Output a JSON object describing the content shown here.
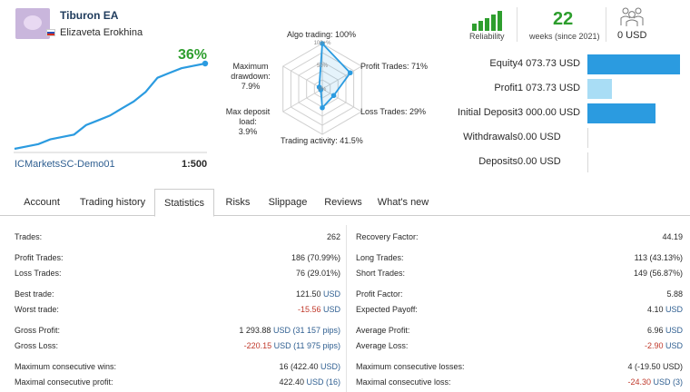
{
  "header": {
    "title": "Tiburon EA",
    "author": "Elizaveta Erokhina",
    "growth": "36%",
    "account": "ICMarketsSC-Demo01",
    "leverage": "1:500"
  },
  "growth_chart": {
    "values": [
      0,
      1,
      2,
      4,
      5,
      6,
      10,
      12,
      14,
      17,
      20,
      24,
      30,
      32,
      34,
      35,
      36
    ]
  },
  "radar": {
    "scale": [
      "100+%",
      "50%",
      "0%"
    ],
    "labels": {
      "algo": "Algo trading: 100%",
      "profit": "Profit Trades: 71%",
      "loss": "Loss Trades: 29%",
      "activity": "Trading activity: 41.5%",
      "load_1": "Max deposit load:",
      "load_2": "3.9%",
      "dd_1": "Maximum",
      "dd_2": "drawdown: 7.9%"
    },
    "values": [
      100,
      71,
      29,
      41.5,
      3.9,
      7.9
    ]
  },
  "metrics": {
    "reliability_label": "Reliability",
    "reliability_bars": 5,
    "weeks": "22",
    "weeks_label": "weeks (since 2021)",
    "subscribers": "0 USD"
  },
  "financials": [
    {
      "name": "Equity",
      "value": "4 073.73 USD",
      "fill": 1.0,
      "color": "#2b9be0"
    },
    {
      "name": "Profit",
      "value": "1 073.73 USD",
      "fill": 0.26,
      "color": "#a9ddf5"
    },
    {
      "name": "Initial Deposit",
      "value": "3 000.00 USD",
      "fill": 0.74,
      "color": "#2b9be0"
    },
    {
      "name": "Withdrawals",
      "value": "0.00 USD",
      "fill": 0,
      "color": "#2b9be0"
    },
    {
      "name": "Deposits",
      "value": "0.00 USD",
      "fill": 0,
      "color": "#2b9be0"
    }
  ],
  "tabs": [
    "Account",
    "Trading history",
    "Statistics",
    "Risks",
    "Slippage",
    "Reviews",
    "What's new"
  ],
  "stats_left": [
    {
      "k": "Trades:",
      "v": "262"
    },
    {
      "k": "Profit Trades:",
      "v": "186 (70.99%)"
    },
    {
      "k": "Loss Trades:",
      "v": "76 (29.01%)"
    },
    {
      "k": "Best trade:",
      "v": "121.50 USD"
    },
    {
      "k": "Worst trade:",
      "v": "-15.56 USD"
    },
    {
      "k": "Gross Profit:",
      "v": "1 293.88 USD (31 157 pips)"
    },
    {
      "k": "Gross Loss:",
      "v": "-220.15 USD (11 975 pips)"
    },
    {
      "k": "Maximum consecutive wins:",
      "v": "16 (422.40 USD)"
    },
    {
      "k": "Maximal consecutive profit:",
      "v": "422.40 USD (16)"
    }
  ],
  "stats_right": [
    {
      "k": "Recovery Factor:",
      "v": "44.19"
    },
    {
      "k": "Long Trades:",
      "v": "113 (43.13%)"
    },
    {
      "k": "Short Trades:",
      "v": "149 (56.87%)"
    },
    {
      "k": "Profit Factor:",
      "v": "5.88"
    },
    {
      "k": "Expected Payoff:",
      "v": "4.10 USD"
    },
    {
      "k": "Average Profit:",
      "v": "6.96 USD"
    },
    {
      "k": "Average Loss:",
      "v": "-2.90 USD"
    },
    {
      "k": "Maximum consecutive losses:",
      "v": "4 (-19.50 USD)"
    },
    {
      "k": "Maximal consecutive loss:",
      "v": "-24.30 USD (3)"
    }
  ]
}
